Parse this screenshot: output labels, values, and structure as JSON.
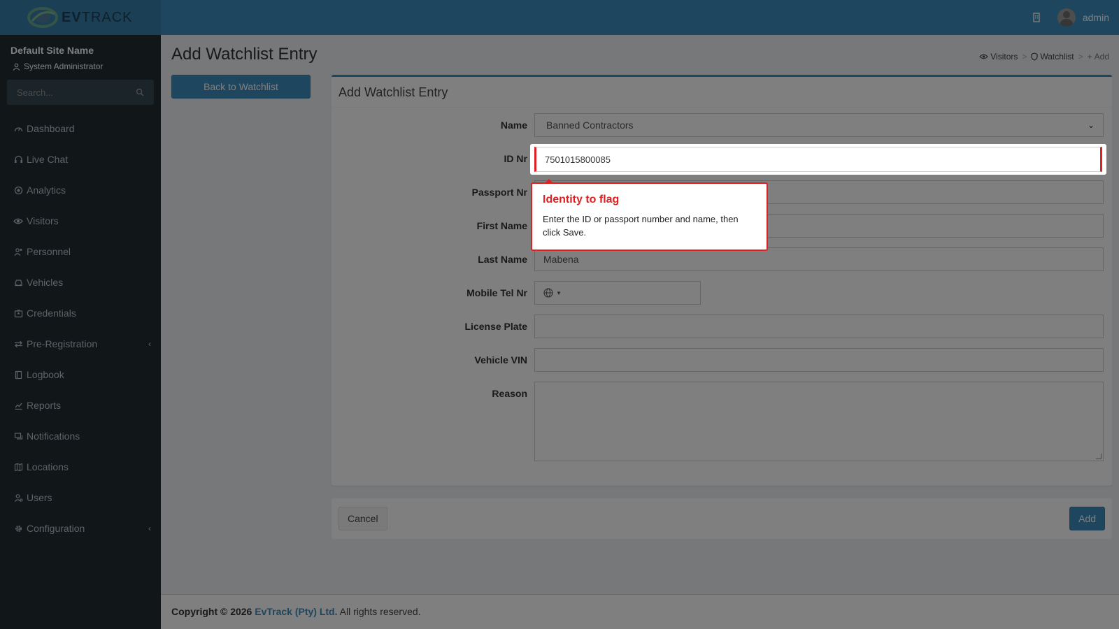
{
  "colors": {
    "accent": "#3c8dbc",
    "sidebar": "#222d32",
    "tour_highlight": "#e02020"
  },
  "header": {
    "logo_text_ev": "EV",
    "logo_text_track": "TRACK",
    "user_name": "admin",
    "icons": [
      "building-icon",
      "avatar"
    ]
  },
  "sidebar": {
    "site_name": "Default Site Name",
    "role": "System Administrator",
    "search_placeholder": "Search...",
    "items": [
      {
        "label": "Dashboard",
        "icon": "dashboard-icon"
      },
      {
        "label": "Live Chat",
        "icon": "headset-icon"
      },
      {
        "label": "Analytics",
        "icon": "target-icon"
      },
      {
        "label": "Visitors",
        "icon": "eye-icon"
      },
      {
        "label": "Personnel",
        "icon": "people-icon"
      },
      {
        "label": "Vehicles",
        "icon": "car-icon"
      },
      {
        "label": "Credentials",
        "icon": "badge-icon"
      },
      {
        "label": "Pre-Registration",
        "icon": "arrows-icon",
        "has_submenu": true
      },
      {
        "label": "Logbook",
        "icon": "book-icon"
      },
      {
        "label": "Reports",
        "icon": "chart-icon"
      },
      {
        "label": "Notifications",
        "icon": "chat-icon"
      },
      {
        "label": "Locations",
        "icon": "map-icon"
      },
      {
        "label": "Users",
        "icon": "user-icon"
      },
      {
        "label": "Configuration",
        "icon": "gear-icon",
        "has_submenu": true
      }
    ]
  },
  "page": {
    "title": "Add Watchlist Entry",
    "back_button": "Back to Watchlist",
    "breadcrumb": [
      "Visitors",
      "Watchlist",
      "Add"
    ]
  },
  "form": {
    "box_title": "Add Watchlist Entry",
    "fields": {
      "name": {
        "label": "Name",
        "value": "Banned Contractors"
      },
      "id_nr": {
        "label": "ID Nr",
        "value": "7501015800085"
      },
      "passport_nr": {
        "label": "Passport Nr",
        "value": ""
      },
      "first_name": {
        "label": "First Name",
        "value": ""
      },
      "last_name": {
        "label": "Last Name",
        "value": "Mabena"
      },
      "mobile": {
        "label": "Mobile Tel Nr",
        "value": ""
      },
      "license_plate": {
        "label": "License Plate",
        "value": ""
      },
      "vin": {
        "label": "Vehicle VIN",
        "value": ""
      },
      "reason": {
        "label": "Reason",
        "value": ""
      }
    },
    "cancel_label": "Cancel",
    "add_label": "Add"
  },
  "tour": {
    "title": "Identity to flag",
    "body": "Enter the ID or passport number and name, then click Save."
  },
  "footer": {
    "prefix": "Copyright © 2026",
    "company": "EvTrack (Pty) Ltd.",
    "suffix": "All rights reserved."
  }
}
